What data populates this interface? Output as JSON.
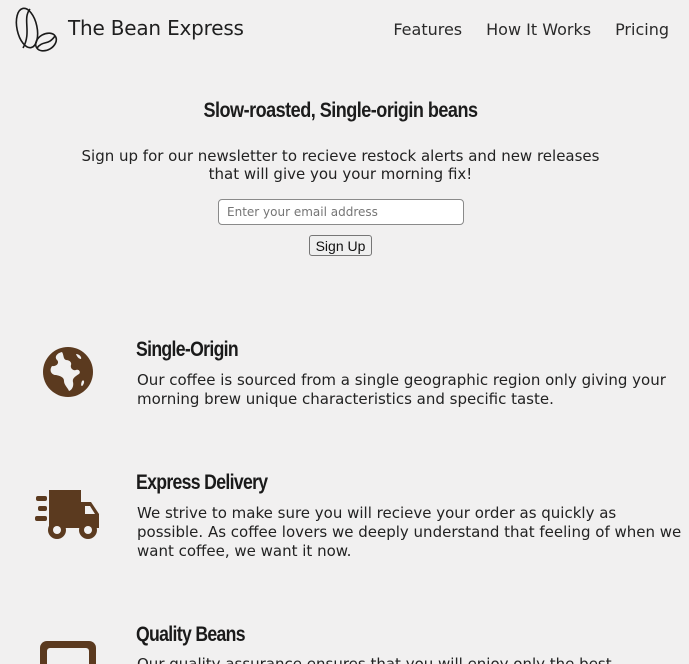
{
  "header": {
    "brand": "The Bean Express",
    "nav": [
      "Features",
      "How It Works",
      "Pricing"
    ]
  },
  "hero": {
    "title": "Slow-roasted, Single-origin beans",
    "text_line1": "Sign up for our newsletter to recieve restock alerts and new releases",
    "text_line2": "that will give you your morning fix!",
    "email_placeholder": "Enter your email address",
    "signup_label": "Sign Up"
  },
  "features": [
    {
      "title": "Single-Origin",
      "text": "Our coffee is sourced from a single geographic region only giving your morning brew unique characteristics and specific taste.",
      "icon": "globe-icon"
    },
    {
      "title": "Express Delivery",
      "text": "We strive to make sure you will recieve your order as quickly as possible. As coffee lovers we deeply understand that feeling of when we want coffee, we want it now.",
      "icon": "delivery-truck-icon"
    },
    {
      "title": "Quality Beans",
      "text": "Our quality assurance ensures that you will enjoy only the best",
      "icon": "quality-icon"
    }
  ],
  "colors": {
    "background": "#f1f0f0",
    "icon_brown": "#5b3a1f"
  }
}
